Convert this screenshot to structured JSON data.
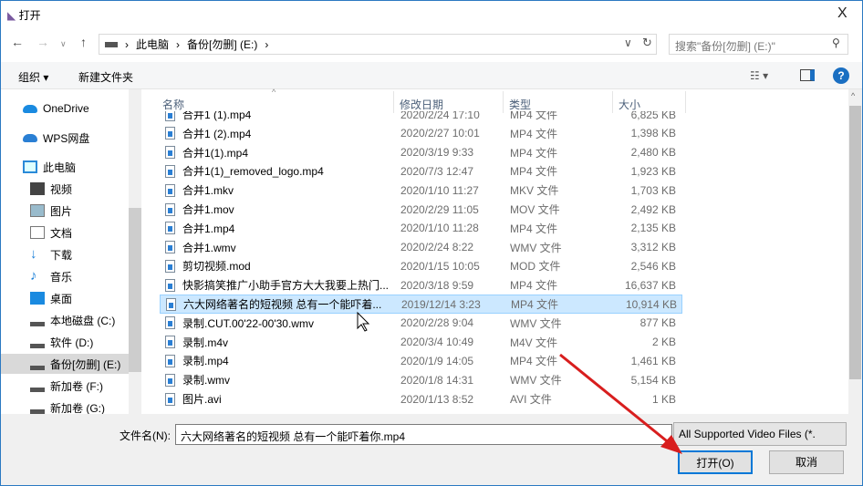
{
  "window": {
    "title": "打开",
    "close": "X"
  },
  "address": {
    "path": [
      "此电脑",
      "备份[勿删] (E:)"
    ],
    "search_placeholder": "搜索\"备份[勿删] (E:)\""
  },
  "toolbar": {
    "organize": "组织 ▾",
    "new_folder": "新建文件夹"
  },
  "sidebar": {
    "items": [
      {
        "label": "OneDrive",
        "icon": "cloud-icon"
      },
      {
        "label": "WPS网盘",
        "icon": "cloud-icon"
      },
      {
        "label": "此电脑",
        "icon": "computer-icon"
      },
      {
        "label": "视频",
        "icon": "video-icon"
      },
      {
        "label": "图片",
        "icon": "picture-icon"
      },
      {
        "label": "文档",
        "icon": "document-icon"
      },
      {
        "label": "下载",
        "icon": "download-icon"
      },
      {
        "label": "音乐",
        "icon": "music-icon"
      },
      {
        "label": "桌面",
        "icon": "desktop-icon"
      },
      {
        "label": "本地磁盘 (C:)",
        "icon": "drive-icon"
      },
      {
        "label": "软件 (D:)",
        "icon": "drive-icon"
      },
      {
        "label": "备份[勿删] (E:)",
        "icon": "drive-icon"
      },
      {
        "label": "新加卷 (F:)",
        "icon": "drive-icon"
      },
      {
        "label": "新加卷 (G:)",
        "icon": "drive-icon"
      }
    ]
  },
  "columns": {
    "name": "名称",
    "date": "修改日期",
    "type": "类型",
    "size": "大小"
  },
  "files": [
    {
      "name": "合并1 (1).mp4",
      "date": "2020/2/24 17:10",
      "type": "MP4 文件",
      "size": "6,825 KB"
    },
    {
      "name": "合并1 (2).mp4",
      "date": "2020/2/27 10:01",
      "type": "MP4 文件",
      "size": "1,398 KB"
    },
    {
      "name": "合并1(1).mp4",
      "date": "2020/3/19 9:33",
      "type": "MP4 文件",
      "size": "2,480 KB"
    },
    {
      "name": "合并1(1)_removed_logo.mp4",
      "date": "2020/7/3 12:47",
      "type": "MP4 文件",
      "size": "1,923 KB"
    },
    {
      "name": "合并1.mkv",
      "date": "2020/1/10 11:27",
      "type": "MKV 文件",
      "size": "1,703 KB"
    },
    {
      "name": "合并1.mov",
      "date": "2020/2/29 11:05",
      "type": "MOV 文件",
      "size": "2,492 KB"
    },
    {
      "name": "合并1.mp4",
      "date": "2020/1/10 11:28",
      "type": "MP4 文件",
      "size": "2,135 KB"
    },
    {
      "name": "合并1.wmv",
      "date": "2020/2/24 8:22",
      "type": "WMV 文件",
      "size": "3,312 KB"
    },
    {
      "name": "剪切视频.mod",
      "date": "2020/1/15 10:05",
      "type": "MOD 文件",
      "size": "2,546 KB"
    },
    {
      "name": "快影搞笑推广小助手官方大大我要上热门...",
      "date": "2020/3/18 9:59",
      "type": "MP4 文件",
      "size": "16,637 KB"
    },
    {
      "name": "六大网络著名的短视频 总有一个能吓着...",
      "date": "2019/12/14 3:23",
      "type": "MP4 文件",
      "size": "10,914 KB",
      "selected": true
    },
    {
      "name": "录制.CUT.00'22-00'30.wmv",
      "date": "2020/2/28 9:04",
      "type": "WMV 文件",
      "size": "877 KB"
    },
    {
      "name": "录制.m4v",
      "date": "2020/3/4 10:49",
      "type": "M4V 文件",
      "size": "2 KB"
    },
    {
      "name": "录制.mp4",
      "date": "2020/1/9 14:05",
      "type": "MP4 文件",
      "size": "1,461 KB"
    },
    {
      "name": "录制.wmv",
      "date": "2020/1/8 14:31",
      "type": "WMV 文件",
      "size": "5,154 KB"
    },
    {
      "name": "图片.avi",
      "date": "2020/1/13 8:52",
      "type": "AVI 文件",
      "size": "1 KB"
    }
  ],
  "footer": {
    "filename_label": "文件名(N):",
    "filename_value": "六大网络著名的短视频 总有一个能吓着你.mp4",
    "filter": "All Supported Video Files (*.",
    "open": "打开(O)",
    "cancel": "取消"
  },
  "colors": {
    "accent": "#0078d7",
    "selection": "#cce8ff",
    "arrow": "#d81e1e"
  }
}
